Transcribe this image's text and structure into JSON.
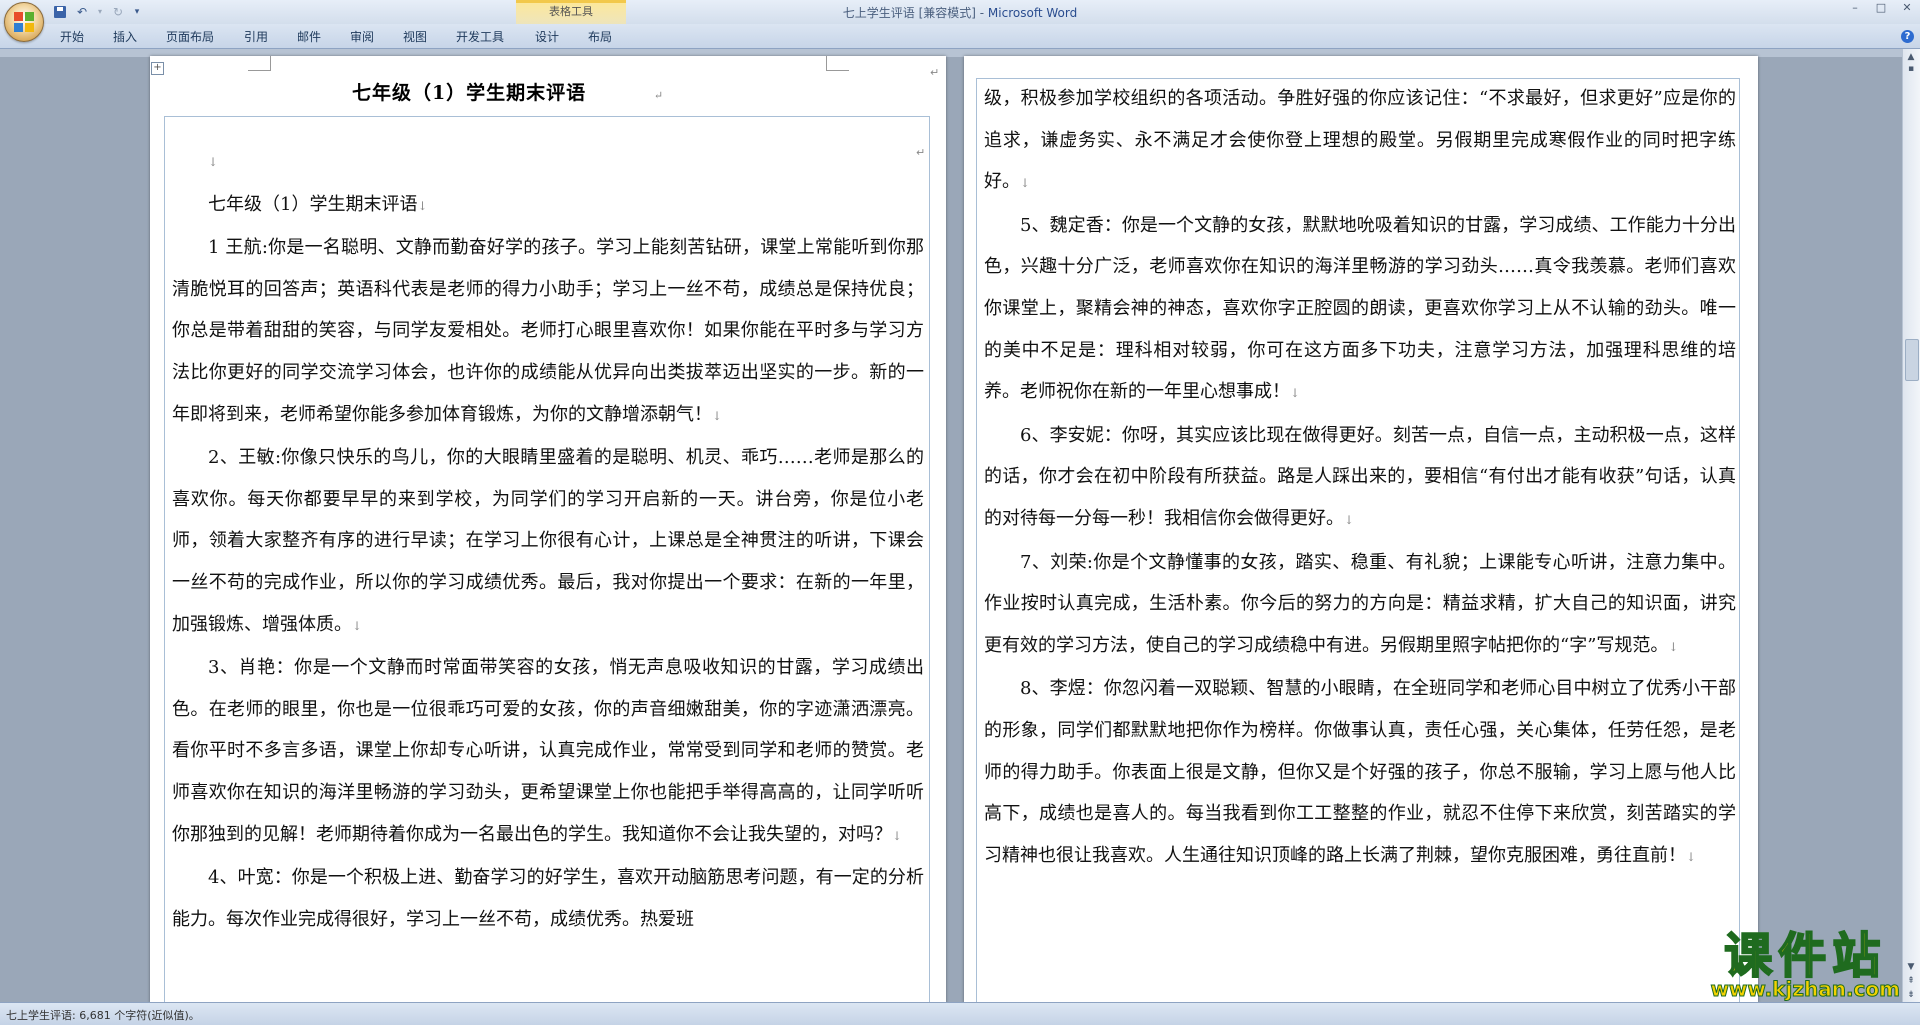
{
  "window": {
    "title": "七上学生评语 [兼容模式] - ",
    "app_name": "Microsoft Word",
    "context_tool": "表格工具",
    "controls": [
      "–",
      "□",
      "✕"
    ]
  },
  "ribbon": {
    "tabs": [
      "开始",
      "插入",
      "页面布局",
      "引用",
      "邮件",
      "审阅",
      "视图",
      "开发工具",
      "设计",
      "布局"
    ],
    "help": "?"
  },
  "document": {
    "title": "七年级（1）学生期末评语",
    "left_paragraphs": [
      {
        "text": "",
        "indent": true
      },
      {
        "text": "七年级（1）学生期末评语",
        "indent": true
      },
      {
        "text": "1 王航:你是一名聪明、文静而勤奋好学的孩子。学习上能刻苦钻研，课堂上常能听到你那清脆悦耳的回答声；英语科代表是老师的得力小助手；学习上一丝不苟，成绩总是保持优良；你总是带着甜甜的笑容，与同学友爱相处。老师打心眼里喜欢你！如果你能在平时多与学习方法比你更好的同学交流学习体会，也许你的成绩能从优异向出类拔萃迈出坚实的一步。新的一年即将到来，老师希望你能多参加体育锻炼，为你的文静增添朝气！",
        "indent": true
      },
      {
        "text": "2、王敏:你像只快乐的鸟儿，你的大眼睛里盛着的是聪明、机灵、乖巧……老师是那么的喜欢你。每天你都要早早的来到学校，为同学们的学习开启新的一天。讲台旁，你是位小老师，领着大家整齐有序的进行早读；在学习上你很有心计，上课总是全神贯注的听讲，下课会一丝不苟的完成作业，所以你的学习成绩优秀。最后，我对你提出一个要求：在新的一年里，加强锻炼、增强体质。",
        "indent": true
      },
      {
        "text": "3、肖艳：你是一个文静而时常面带笑容的女孩，悄无声息吸收知识的甘露，学习成绩出色。在老师的眼里，你也是一位很乖巧可爱的女孩，你的声音细嫩甜美，你的字迹潇洒漂亮。看你平时不多言多语，课堂上你却专心听讲，认真完成作业，常常受到同学和老师的赞赏。老师喜欢你在知识的海洋里畅游的学习劲头，更希望课堂上你也能把手举得高高的，让同学听听你那独到的见解！老师期待着你成为一名最出色的学生。我知道你不会让我失望的，对吗？",
        "indent": true
      },
      {
        "text": "4、叶宽：你是一个积极上进、勤奋学习的好学生，喜欢开动脑筋思考问题，有一定的分析能力。每次作业完成得很好，学习上一丝不苟，成绩优秀。热爱班",
        "indent": true,
        "no_mark": true
      }
    ],
    "right_paragraphs": [
      {
        "text": "级，积极参加学校组织的各项活动。争胜好强的你应该记住：“不求最好，但求更好”应是你的追求，谦虚务实、永不满足才会使你登上理想的殿堂。另假期里完成寒假作业的同时把字练好。",
        "indent": false
      },
      {
        "text": "5、魏定香：你是一个文静的女孩，默默地吮吸着知识的甘露，学习成绩、工作能力十分出色，兴趣十分广泛，老师喜欢你在知识的海洋里畅游的学习劲头……真令我羡慕。老师们喜欢你课堂上，聚精会神的神态，喜欢你字正腔圆的朗读，更喜欢你学习上从不认输的劲头。唯一的美中不足是：理科相对较弱，你可在这方面多下功夫，注意学习方法，加强理科思维的培养。老师祝你在新的一年里心想事成！",
        "indent": true
      },
      {
        "text": "6、李安妮：你呀，其实应该比现在做得更好。刻苦一点，自信一点，主动积极一点，这样的话，你才会在初中阶段有所获益。路是人踩出来的，要相信“有付出才能有收获”句话，认真的对待每一分每一秒！我相信你会做得更好。",
        "indent": true
      },
      {
        "text": "7、刘荣:你是个文静懂事的女孩，踏实、稳重、有礼貌；上课能专心听讲，注意力集中。作业按时认真完成，生活朴素。你今后的努力的方向是：精益求精，扩大自己的知识面，讲究更有效的学习方法，使自己的学习成绩稳中有进。另假期里照字帖把你的“字”写规范。",
        "indent": true
      },
      {
        "text": "8、李煜：你忽闪着一双聪颖、智慧的小眼睛，在全班同学和老师心目中树立了优秀小干部的形象，同学们都默默地把你作为榜样。你做事认真，责任心强，关心集体，任劳任怨，是老师的得力助手。你表面上很是文静，但你又是个好强的孩子，你总不服输，学习上愿与他人比高下，成绩也是喜人的。每当我看到你工工整整的作业，就忍不住停下来欣赏，刻苦踏实的学习精神也很让我喜欢。人生通往知识顶峰的路上长满了荆棘，望你克服困难，勇往直前！",
        "indent": true
      }
    ],
    "para_mark": "↓",
    "cell_mark": "↵"
  },
  "status": {
    "text": "七上学生评语: 6,681 个字符(近似值)。"
  },
  "watermark": {
    "main": "课件站",
    "url": "www.kjzhan.com"
  },
  "colors": {
    "title_bar": "#dbe5f2",
    "app_name": "#2a4d8f",
    "context_tab": "#f2c84b",
    "workspace": "#9aa7b8",
    "watermark": "#f3d200"
  }
}
